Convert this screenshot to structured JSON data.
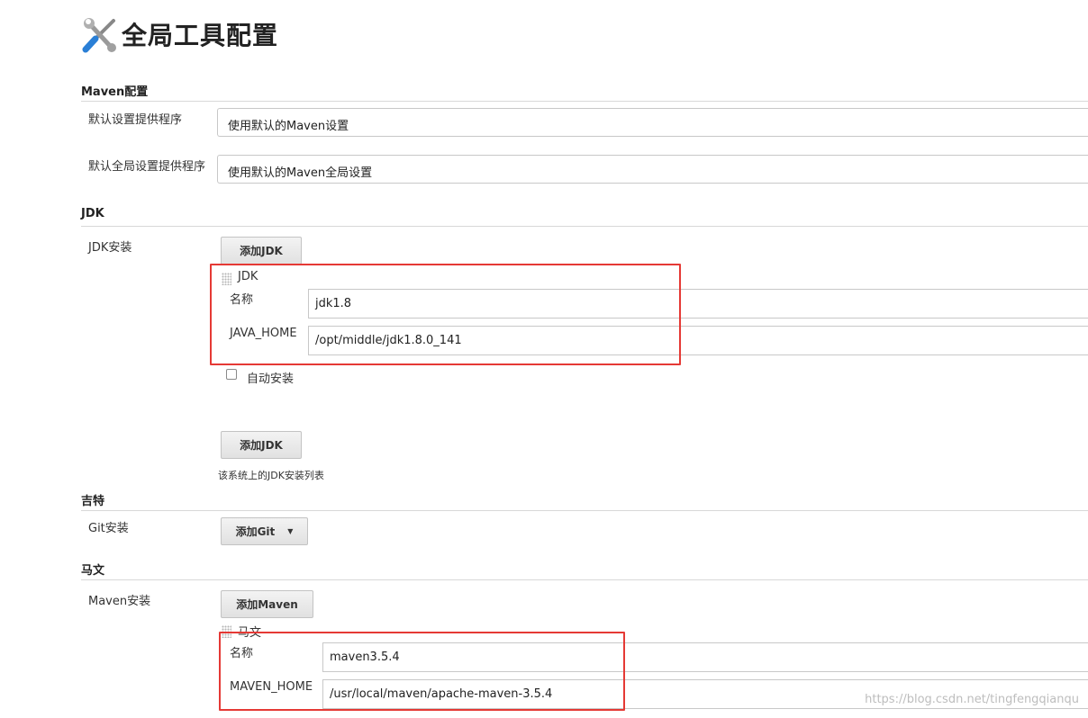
{
  "page": {
    "title": "全局工具配置",
    "icon": "tools-icon"
  },
  "maven_config": {
    "heading": "Maven配置",
    "default_settings_label": "默认设置提供程序",
    "default_settings_value": "使用默认的Maven设置",
    "global_settings_label": "默认全局设置提供程序",
    "global_settings_value": "使用默认的Maven全局设置"
  },
  "jdk": {
    "heading": "JDK",
    "install_label": "JDK安装",
    "add_button": "添加JDK",
    "entry_title": "JDK",
    "name_label": "名称",
    "name_value": "jdk1.8",
    "home_label": "JAVA_HOME",
    "home_value": "/opt/middle/jdk1.8.0_141",
    "auto_install_label": "自动安装",
    "auto_install_checked": false,
    "add_button_bottom": "添加JDK",
    "help_text": "该系统上的JDK安装列表"
  },
  "git": {
    "heading": "吉特",
    "install_label": "Git安装",
    "add_button": "添加Git"
  },
  "maven": {
    "heading": "马文",
    "install_label": "Maven安装",
    "add_button": "添加Maven",
    "entry_title": "马文",
    "name_label": "名称",
    "name_value": "maven3.5.4",
    "home_label": "MAVEN_HOME",
    "home_value": "/usr/local/maven/apache-maven-3.5.4"
  },
  "watermark": "https://blog.csdn.net/tingfengqianqu",
  "colors": {
    "highlight_box": "#e53935",
    "rule": "#d8d8d8"
  }
}
